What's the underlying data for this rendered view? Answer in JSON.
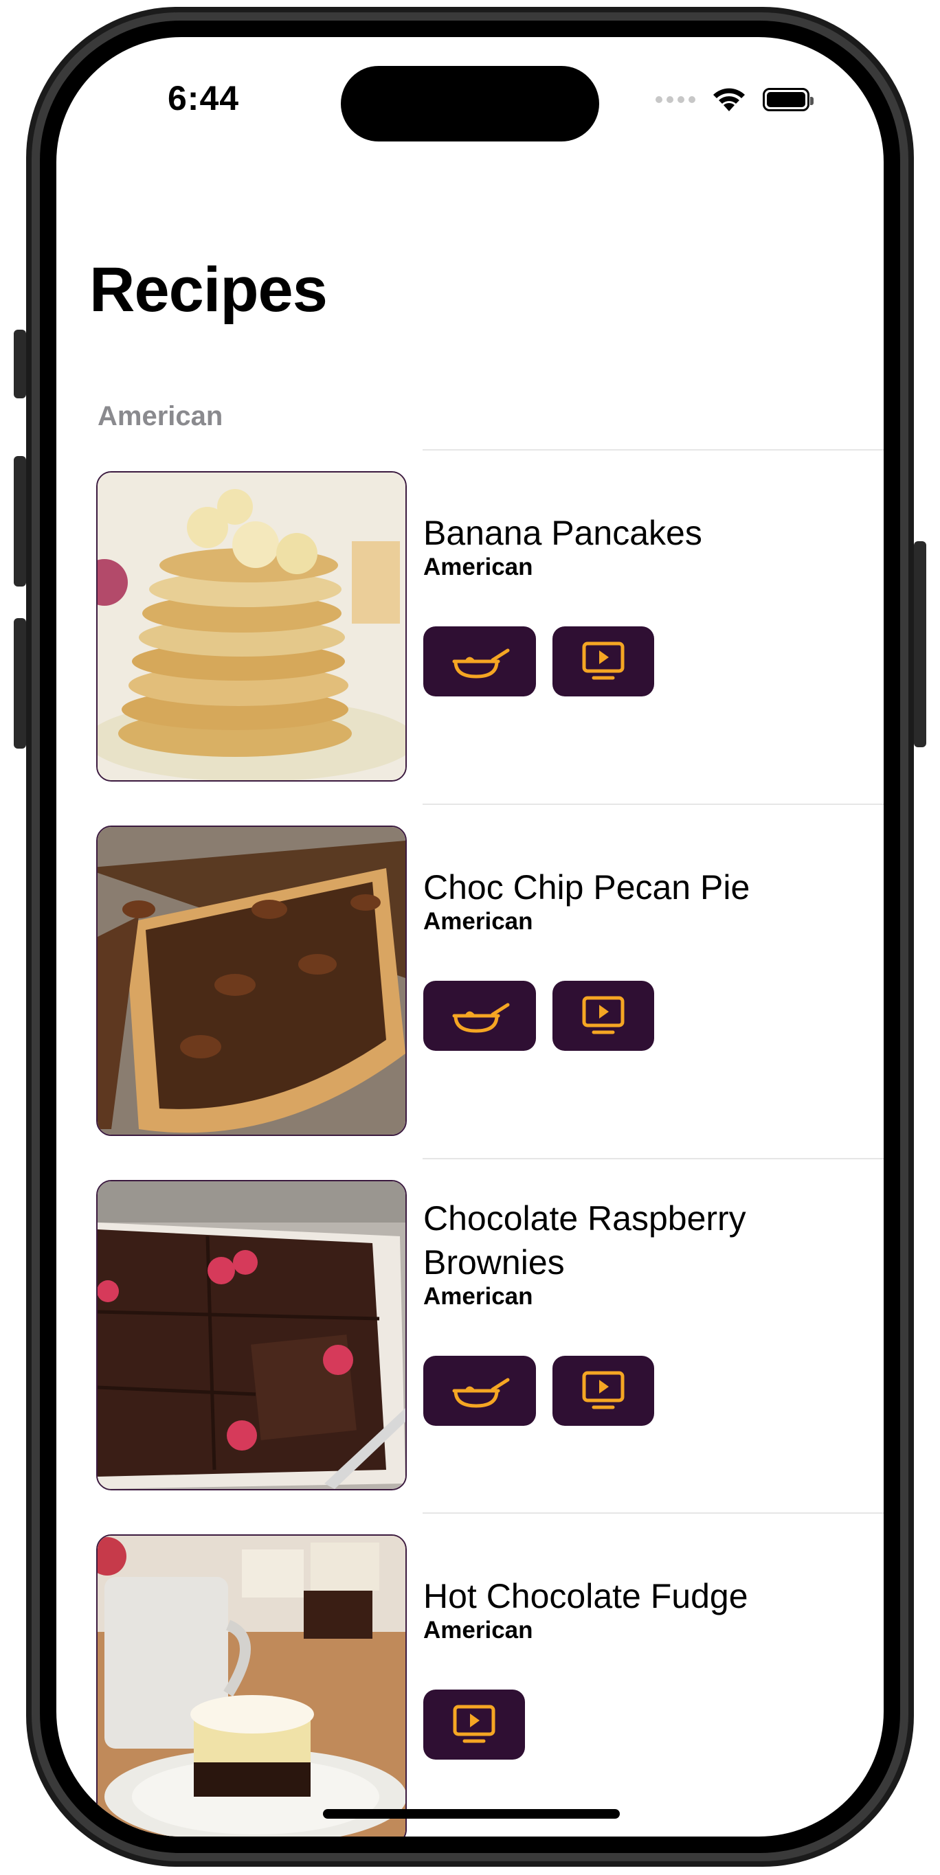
{
  "status_bar": {
    "time": "6:44"
  },
  "page": {
    "title": "Recipes"
  },
  "sections": [
    {
      "header": "American",
      "recipes": [
        {
          "name": "Banana Pancakes",
          "cuisine": "American",
          "has_recipe_button": true,
          "has_video_button": true
        },
        {
          "name": "Choc Chip Pecan Pie",
          "cuisine": "American",
          "has_recipe_button": true,
          "has_video_button": true
        },
        {
          "name": "Chocolate Raspberry Brownies",
          "cuisine": "American",
          "has_recipe_button": true,
          "has_video_button": true
        },
        {
          "name": "Hot Chocolate Fudge",
          "cuisine": "American",
          "has_recipe_button": false,
          "has_video_button": true
        }
      ]
    }
  ],
  "colors": {
    "button_bg": "#2f0f33",
    "icon_accent": "#f5a623",
    "thumbnail_border": "#3b1a3f",
    "section_header": "#8a8a8e"
  },
  "icons": {
    "recipe_button": "cooking-pan-icon",
    "video_button": "play-video-icon"
  }
}
